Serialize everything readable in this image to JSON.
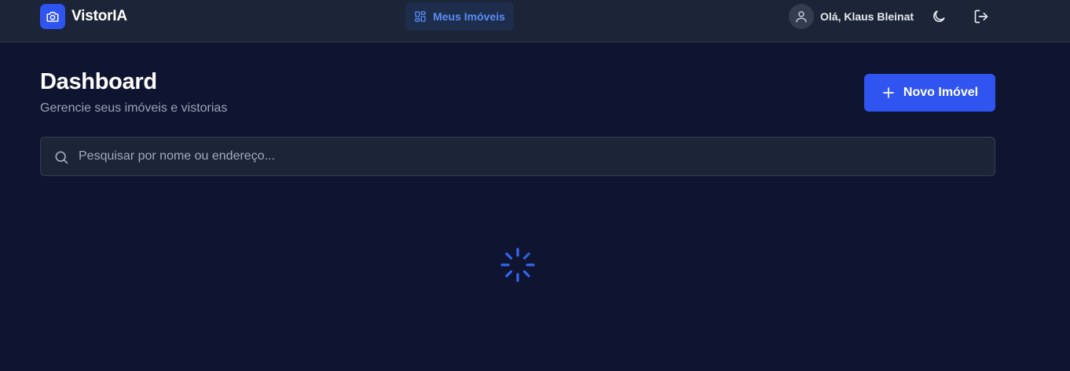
{
  "app": {
    "name": "VistorIA",
    "logo_icon": "camera-icon"
  },
  "nav": {
    "tab_label": "Meus Imóveis",
    "tab_icon": "grid-icon"
  },
  "user": {
    "greeting": "Olá, Klaus Bleinat",
    "avatar_icon": "user-icon"
  },
  "header_actions": {
    "theme_icon": "moon-icon",
    "logout_icon": "logout-icon"
  },
  "page": {
    "title": "Dashboard",
    "subtitle": "Gerencie seus imóveis e vistorias",
    "new_button_label": "Novo Imóvel"
  },
  "search": {
    "placeholder": "Pesquisar por nome ou endereço...",
    "value": ""
  },
  "colors": {
    "accent": "#2f54f0",
    "background": "#0f1530",
    "navbar": "#1c2537",
    "spinner": "#3366f0"
  },
  "status": {
    "loading": true
  }
}
